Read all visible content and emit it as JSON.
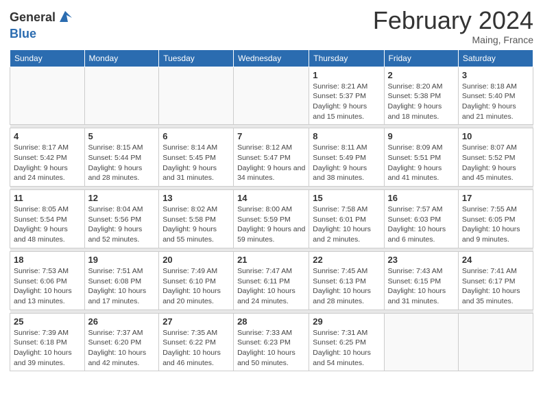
{
  "logo": {
    "general": "General",
    "blue": "Blue"
  },
  "title": "February 2024",
  "location": "Maing, France",
  "days_of_week": [
    "Sunday",
    "Monday",
    "Tuesday",
    "Wednesday",
    "Thursday",
    "Friday",
    "Saturday"
  ],
  "weeks": [
    [
      {
        "day": "",
        "info": ""
      },
      {
        "day": "",
        "info": ""
      },
      {
        "day": "",
        "info": ""
      },
      {
        "day": "",
        "info": ""
      },
      {
        "day": "1",
        "info": "Sunrise: 8:21 AM\nSunset: 5:37 PM\nDaylight: 9 hours and 15 minutes."
      },
      {
        "day": "2",
        "info": "Sunrise: 8:20 AM\nSunset: 5:38 PM\nDaylight: 9 hours and 18 minutes."
      },
      {
        "day": "3",
        "info": "Sunrise: 8:18 AM\nSunset: 5:40 PM\nDaylight: 9 hours and 21 minutes."
      }
    ],
    [
      {
        "day": "4",
        "info": "Sunrise: 8:17 AM\nSunset: 5:42 PM\nDaylight: 9 hours and 24 minutes."
      },
      {
        "day": "5",
        "info": "Sunrise: 8:15 AM\nSunset: 5:44 PM\nDaylight: 9 hours and 28 minutes."
      },
      {
        "day": "6",
        "info": "Sunrise: 8:14 AM\nSunset: 5:45 PM\nDaylight: 9 hours and 31 minutes."
      },
      {
        "day": "7",
        "info": "Sunrise: 8:12 AM\nSunset: 5:47 PM\nDaylight: 9 hours and 34 minutes."
      },
      {
        "day": "8",
        "info": "Sunrise: 8:11 AM\nSunset: 5:49 PM\nDaylight: 9 hours and 38 minutes."
      },
      {
        "day": "9",
        "info": "Sunrise: 8:09 AM\nSunset: 5:51 PM\nDaylight: 9 hours and 41 minutes."
      },
      {
        "day": "10",
        "info": "Sunrise: 8:07 AM\nSunset: 5:52 PM\nDaylight: 9 hours and 45 minutes."
      }
    ],
    [
      {
        "day": "11",
        "info": "Sunrise: 8:05 AM\nSunset: 5:54 PM\nDaylight: 9 hours and 48 minutes."
      },
      {
        "day": "12",
        "info": "Sunrise: 8:04 AM\nSunset: 5:56 PM\nDaylight: 9 hours and 52 minutes."
      },
      {
        "day": "13",
        "info": "Sunrise: 8:02 AM\nSunset: 5:58 PM\nDaylight: 9 hours and 55 minutes."
      },
      {
        "day": "14",
        "info": "Sunrise: 8:00 AM\nSunset: 5:59 PM\nDaylight: 9 hours and 59 minutes."
      },
      {
        "day": "15",
        "info": "Sunrise: 7:58 AM\nSunset: 6:01 PM\nDaylight: 10 hours and 2 minutes."
      },
      {
        "day": "16",
        "info": "Sunrise: 7:57 AM\nSunset: 6:03 PM\nDaylight: 10 hours and 6 minutes."
      },
      {
        "day": "17",
        "info": "Sunrise: 7:55 AM\nSunset: 6:05 PM\nDaylight: 10 hours and 9 minutes."
      }
    ],
    [
      {
        "day": "18",
        "info": "Sunrise: 7:53 AM\nSunset: 6:06 PM\nDaylight: 10 hours and 13 minutes."
      },
      {
        "day": "19",
        "info": "Sunrise: 7:51 AM\nSunset: 6:08 PM\nDaylight: 10 hours and 17 minutes."
      },
      {
        "day": "20",
        "info": "Sunrise: 7:49 AM\nSunset: 6:10 PM\nDaylight: 10 hours and 20 minutes."
      },
      {
        "day": "21",
        "info": "Sunrise: 7:47 AM\nSunset: 6:11 PM\nDaylight: 10 hours and 24 minutes."
      },
      {
        "day": "22",
        "info": "Sunrise: 7:45 AM\nSunset: 6:13 PM\nDaylight: 10 hours and 28 minutes."
      },
      {
        "day": "23",
        "info": "Sunrise: 7:43 AM\nSunset: 6:15 PM\nDaylight: 10 hours and 31 minutes."
      },
      {
        "day": "24",
        "info": "Sunrise: 7:41 AM\nSunset: 6:17 PM\nDaylight: 10 hours and 35 minutes."
      }
    ],
    [
      {
        "day": "25",
        "info": "Sunrise: 7:39 AM\nSunset: 6:18 PM\nDaylight: 10 hours and 39 minutes."
      },
      {
        "day": "26",
        "info": "Sunrise: 7:37 AM\nSunset: 6:20 PM\nDaylight: 10 hours and 42 minutes."
      },
      {
        "day": "27",
        "info": "Sunrise: 7:35 AM\nSunset: 6:22 PM\nDaylight: 10 hours and 46 minutes."
      },
      {
        "day": "28",
        "info": "Sunrise: 7:33 AM\nSunset: 6:23 PM\nDaylight: 10 hours and 50 minutes."
      },
      {
        "day": "29",
        "info": "Sunrise: 7:31 AM\nSunset: 6:25 PM\nDaylight: 10 hours and 54 minutes."
      },
      {
        "day": "",
        "info": ""
      },
      {
        "day": "",
        "info": ""
      }
    ]
  ]
}
